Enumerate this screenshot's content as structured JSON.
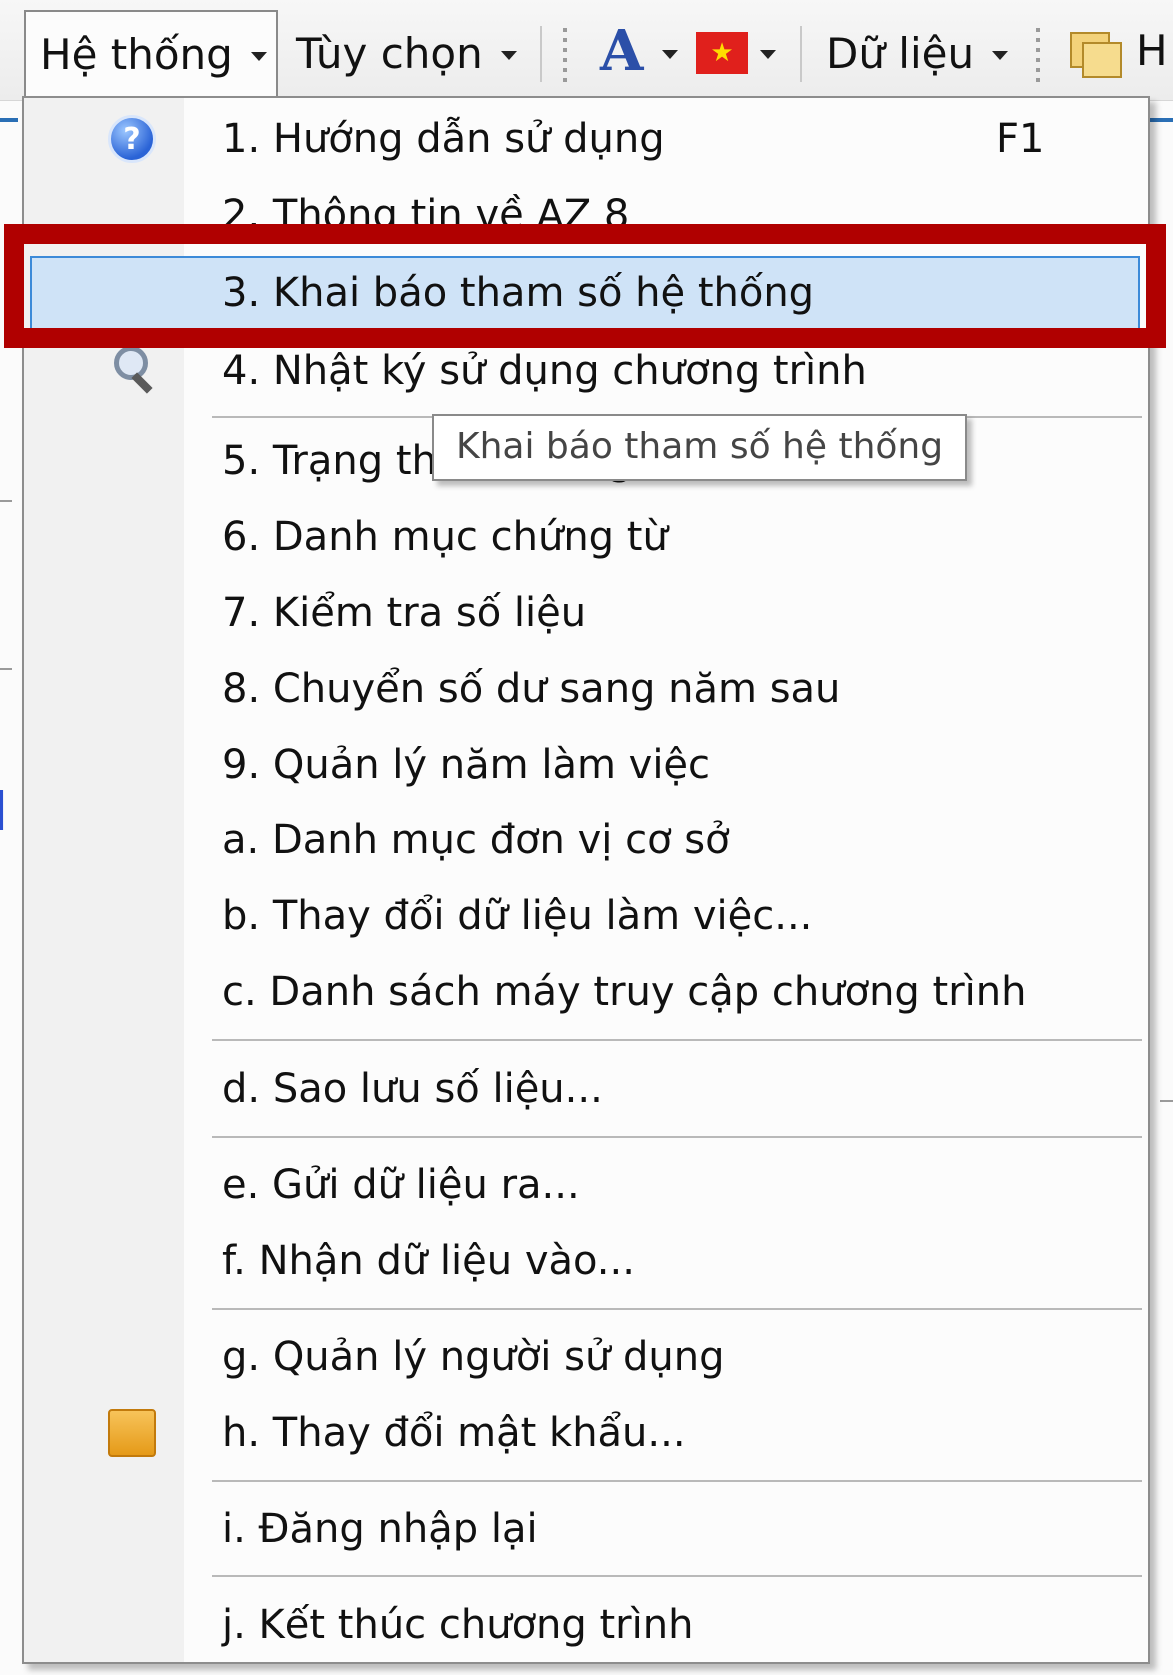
{
  "toolbar": {
    "menus": [
      {
        "label": "Hệ thống",
        "active": true
      },
      {
        "label": "Tùy chọn"
      },
      {
        "label": "Dữ liệu"
      }
    ],
    "font_button_glyph": "A",
    "font_button_icon": "font-color-icon",
    "language_icon": "vietnam-flag-icon",
    "flag_star": "★",
    "folder_icon": "folder-icon",
    "cut_label": "H"
  },
  "menu": {
    "items": [
      {
        "label": "1. Hướng dẫn sử dụng",
        "shortcut": "F1",
        "icon": "help-icon"
      },
      {
        "label": "2. Thông tin về AZ 8"
      },
      {
        "label": "3. Khai báo tham số hệ thống",
        "highlighted": true
      },
      {
        "label": "4. Nhật ký sử dụng chương trình",
        "icon": "search-icon"
      },
      {
        "label": "5. Trạng thái chương trình"
      },
      {
        "label": "6. Danh mục chứng từ"
      },
      {
        "label": "7. Kiểm tra số liệu"
      },
      {
        "label": "8. Chuyển số dư sang năm sau"
      },
      {
        "label": "9. Quản lý năm làm việc"
      },
      {
        "label": "a. Danh mục đơn vị cơ sở"
      },
      {
        "label": "b. Thay đổi dữ liệu làm việc..."
      },
      {
        "label": "c. Danh sách máy truy cập chương trình"
      },
      {
        "label": "d. Sao lưu số liệu..."
      },
      {
        "label": "e. Gửi dữ liệu ra..."
      },
      {
        "label": "f. Nhận dữ liệu vào..."
      },
      {
        "label": "g. Quản lý người sử dụng"
      },
      {
        "label": "h. Thay đổi mật khẩu...",
        "icon": "key-icon"
      },
      {
        "label": "i. Đăng nhập lại"
      },
      {
        "label": "j. Kết thúc chương trình"
      }
    ]
  },
  "tooltip": {
    "text": "Khai báo tham số hệ thống"
  },
  "colors": {
    "highlight_bg": "#cfe3f7",
    "highlight_border": "#3c8ad8",
    "annotation_red": "#b00000"
  }
}
